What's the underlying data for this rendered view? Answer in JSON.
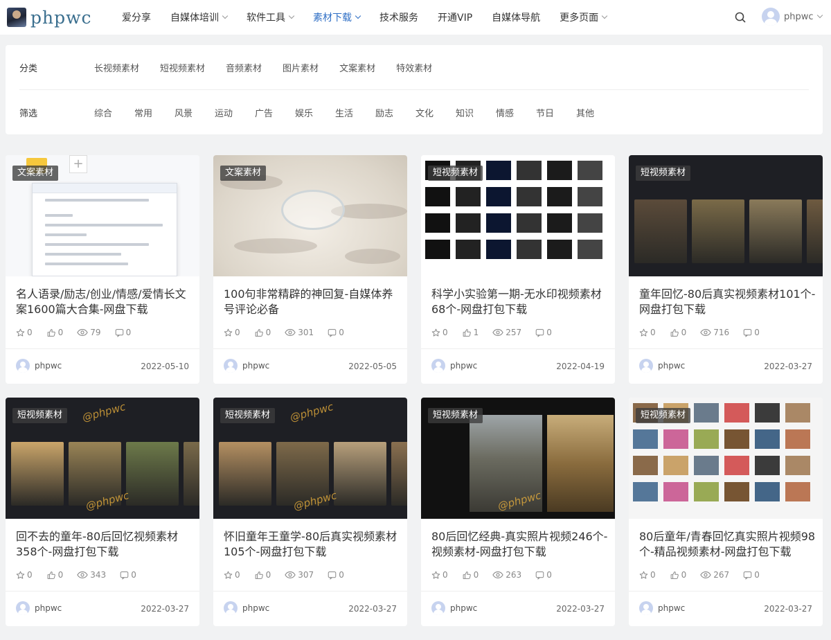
{
  "header": {
    "logo_text": "phpwc",
    "nav": [
      {
        "label": "爱分享",
        "dropdown": false,
        "active": false
      },
      {
        "label": "自媒体培训",
        "dropdown": true,
        "active": false
      },
      {
        "label": "软件工具",
        "dropdown": true,
        "active": false
      },
      {
        "label": "素材下载",
        "dropdown": true,
        "active": true
      },
      {
        "label": "技术服务",
        "dropdown": false,
        "active": false
      },
      {
        "label": "开通VIP",
        "dropdown": false,
        "active": false
      },
      {
        "label": "自媒体导航",
        "dropdown": false,
        "active": false
      },
      {
        "label": "更多页面",
        "dropdown": true,
        "active": false
      }
    ],
    "user_name": "phpwc",
    "accent_color": "#2f6fc5"
  },
  "filter": {
    "category_label": "分类",
    "categories": [
      "长视频素材",
      "短视频素材",
      "音频素材",
      "图片素材",
      "文案素材",
      "特效素材"
    ],
    "screen_label": "筛选",
    "screens": [
      "综合",
      "常用",
      "风景",
      "运动",
      "广告",
      "娱乐",
      "生活",
      "励志",
      "文化",
      "知识",
      "情感",
      "节日",
      "其他"
    ]
  },
  "cards": [
    {
      "badge": "文案素材",
      "title": "名人语录/励志/创业/情感/爱情长文案1600篇大合集-网盘下载",
      "stars": "0",
      "likes": "0",
      "views": "79",
      "comments": "0",
      "author": "phpwc",
      "date": "2022-05-10",
      "thumb": "doc"
    },
    {
      "badge": "文案素材",
      "title": "100句非常精辟的神回复-自媒体养号评论必备",
      "stars": "0",
      "likes": "0",
      "views": "301",
      "comments": "0",
      "author": "phpwc",
      "date": "2022-05-05",
      "thumb": "paper"
    },
    {
      "badge": "短视频素材",
      "title": "科学小实验第一期-无水印视频素材68个-网盘打包下载",
      "stars": "0",
      "likes": "1",
      "views": "257",
      "comments": "0",
      "author": "phpwc",
      "date": "2022-04-19",
      "thumb": "grid-dark"
    },
    {
      "badge": "短视频素材",
      "title": "童年回忆-80后真实视频素材101个-网盘打包下载",
      "stars": "0",
      "likes": "0",
      "views": "716",
      "comments": "0",
      "author": "phpwc",
      "date": "2022-03-27",
      "thumb": "phones"
    },
    {
      "badge": "短视频素材",
      "title": "回不去的童年-80后回忆视频素材358个-网盘打包下载",
      "stars": "0",
      "likes": "0",
      "views": "343",
      "comments": "0",
      "author": "phpwc",
      "date": "2022-03-27",
      "thumb": "phones2"
    },
    {
      "badge": "短视频素材",
      "title": "怀旧童年王童学-80后真实视频素材105个-网盘打包下载",
      "stars": "0",
      "likes": "0",
      "views": "307",
      "comments": "0",
      "author": "phpwc",
      "date": "2022-03-27",
      "thumb": "phones3"
    },
    {
      "badge": "短视频素材",
      "title": "80后回忆经典-真实照片视频246个-视频素材-网盘打包下载",
      "stars": "0",
      "likes": "0",
      "views": "263",
      "comments": "0",
      "author": "phpwc",
      "date": "2022-03-27",
      "thumb": "wall"
    },
    {
      "badge": "短视频素材",
      "title": "80后童年/青春回忆真实照片视频98个-精品视频素材-网盘打包下载",
      "stars": "0",
      "likes": "0",
      "views": "267",
      "comments": "0",
      "author": "phpwc",
      "date": "2022-03-27",
      "thumb": "grid-light"
    }
  ],
  "icons": {
    "star": "star-icon",
    "like": "thumbs-up-icon",
    "view": "eye-icon",
    "comment": "comment-icon"
  }
}
